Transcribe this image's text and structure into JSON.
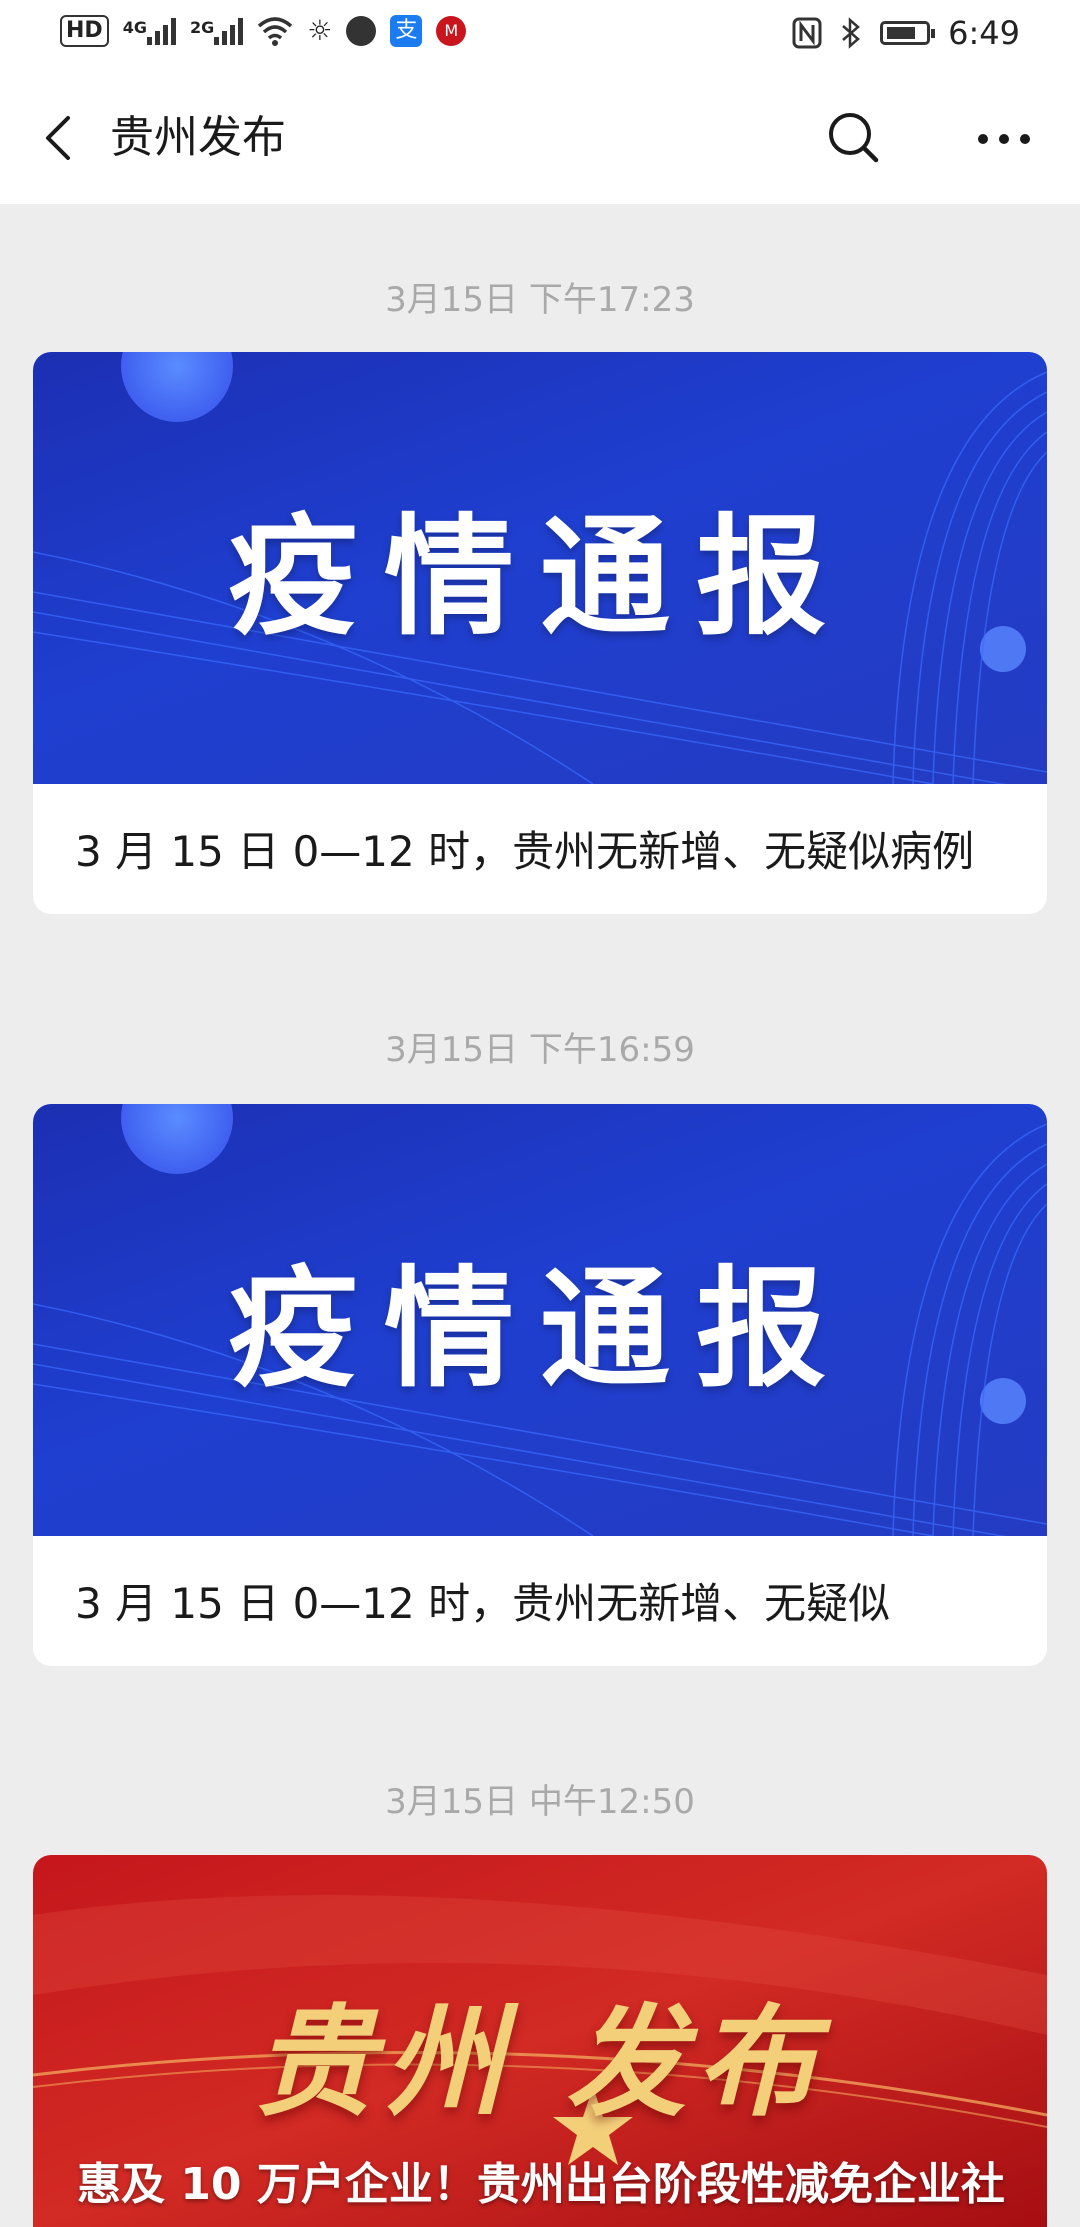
{
  "status_bar": {
    "left_icons": [
      "hd-icon",
      "signal-4g-icon",
      "signal-2g-icon",
      "wifi-icon",
      "brightness-icon",
      "location-app-icon",
      "alipay-icon",
      "cmb-app-icon"
    ],
    "hd_label": "HD",
    "sig1_label": "4G",
    "sig2_label": "2G",
    "alipay_label": "支",
    "cmb_label": "M",
    "time": "6:49"
  },
  "nav": {
    "title": "贵州发布"
  },
  "feed": [
    {
      "timestamp": "3月15日 下午17:23",
      "cover_text": "疫情通报",
      "caption": "3 月 15 日 0—12 时，贵州无新增、无疑似病例"
    },
    {
      "timestamp": "3月15日 下午16:59",
      "cover_text": "疫情通报",
      "caption": "3 月 15 日 0—12 时，贵州无新增、无疑似"
    },
    {
      "timestamp": "3月15日 中午12:50",
      "cover_brand": "贵州 发布",
      "headline": "惠及 10 万户企业！贵州出台阶段性减免企业社"
    }
  ],
  "colors": {
    "background": "#ededed",
    "timestamp": "#a9a9a9",
    "cover_blue": "#1f3fd0",
    "cover_red": "#c5171c",
    "brand_gold": "#f3cf7a"
  }
}
